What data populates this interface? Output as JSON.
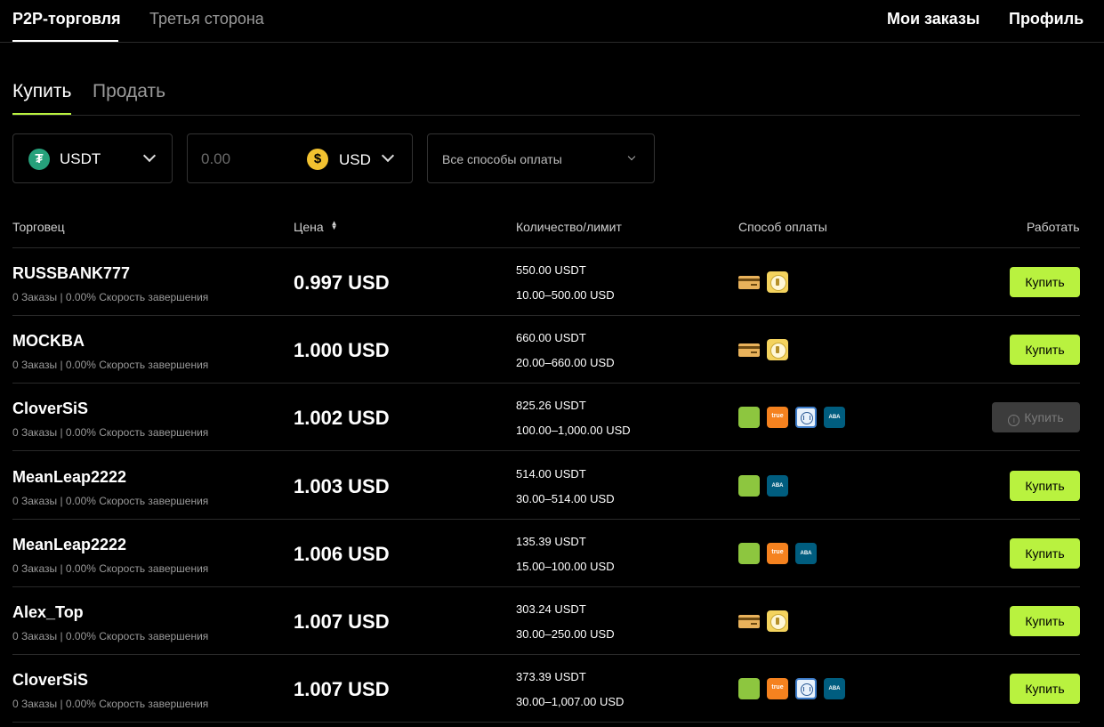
{
  "topnav": {
    "tabs": [
      "P2P-торговля",
      "Третья сторона"
    ],
    "my_orders": "Мои заказы",
    "profile": "Профиль"
  },
  "side_tabs": [
    "Купить",
    "Продать"
  ],
  "filters": {
    "coin": "USDT",
    "amount_placeholder": "0.00",
    "fiat": "USD",
    "payment": "Все способы оплаты"
  },
  "table": {
    "headers": [
      "Торговец",
      "Цена",
      "Количество/лимит",
      "Способ оплаты",
      "Работать"
    ],
    "rows": [
      {
        "trader": "RUSSBANK777",
        "stats": "0 Заказы | 0.00% Скорость завершения",
        "price": "0.997 USD",
        "qty": "550.00 USDT",
        "limit": "10.00–500.00 USD",
        "payments": [
          "card",
          "sber"
        ],
        "action": "Купить",
        "disabled": false
      },
      {
        "trader": "MOCKBA",
        "stats": "0 Заказы | 0.00% Скорость завершения",
        "price": "1.000 USD",
        "qty": "660.00 USDT",
        "limit": "20.00–660.00 USD",
        "payments": [
          "card",
          "sber"
        ],
        "action": "Купить",
        "disabled": false
      },
      {
        "trader": "CloverSiS",
        "stats": "0 Заказы | 0.00% Скорость завершения",
        "price": "1.002 USD",
        "qty": "825.26 USDT",
        "limit": "100.00–1,000.00 USD",
        "payments": [
          "green",
          "truemoney",
          "bank",
          "aba"
        ],
        "action": "Купить",
        "disabled": true
      },
      {
        "trader": "MeanLeap2222",
        "stats": "0 Заказы | 0.00% Скорость завершения",
        "price": "1.003 USD",
        "qty": "514.00 USDT",
        "limit": "30.00–514.00 USD",
        "payments": [
          "green",
          "aba"
        ],
        "action": "Купить",
        "disabled": false
      },
      {
        "trader": "MeanLeap2222",
        "stats": "0 Заказы | 0.00% Скорость завершения",
        "price": "1.006 USD",
        "qty": "135.39 USDT",
        "limit": "15.00–100.00 USD",
        "payments": [
          "green",
          "truemoney",
          "aba"
        ],
        "action": "Купить",
        "disabled": false
      },
      {
        "trader": "Alex_Top",
        "stats": "0 Заказы | 0.00% Скорость завершения",
        "price": "1.007 USD",
        "qty": "303.24 USDT",
        "limit": "30.00–250.00 USD",
        "payments": [
          "card",
          "sber"
        ],
        "action": "Купить",
        "disabled": false
      },
      {
        "trader": "CloverSiS",
        "stats": "0 Заказы | 0.00% Скорость завершения",
        "price": "1.007 USD",
        "qty": "373.39 USDT",
        "limit": "30.00–1,007.00 USD",
        "payments": [
          "green",
          "truemoney",
          "bank",
          "aba"
        ],
        "action": "Купить",
        "disabled": false
      }
    ]
  },
  "colors": {
    "accent": "#b9f23f",
    "background": "#000000"
  }
}
